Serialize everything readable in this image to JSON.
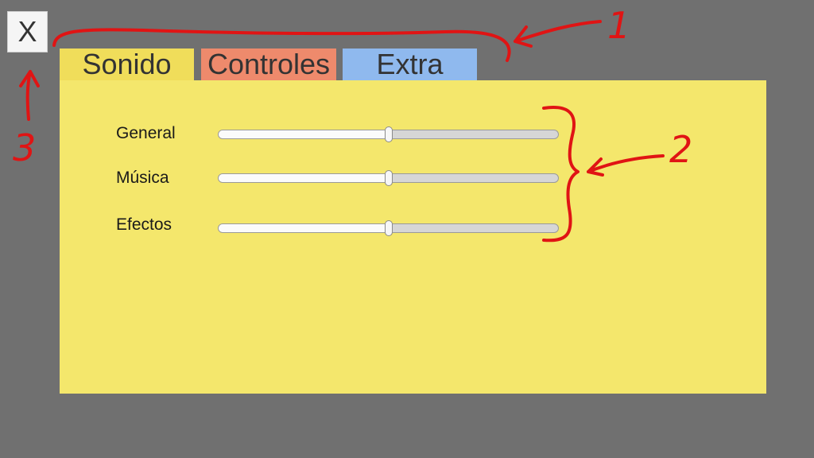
{
  "close_button": {
    "label": "X"
  },
  "tabs": [
    {
      "label": "Sonido",
      "color": "#f0dd5a",
      "selected": true
    },
    {
      "label": "Controles",
      "color": "#ee8a6c",
      "selected": false
    },
    {
      "label": "Extra",
      "color": "#8fb9ee",
      "selected": false
    }
  ],
  "panel": {
    "background": "#f4e76c",
    "sliders": [
      {
        "label": "General",
        "value": 0.5
      },
      {
        "label": "Música",
        "value": 0.5
      },
      {
        "label": "Efectos",
        "value": 0.5
      }
    ]
  },
  "annotations": {
    "color": "#e01414",
    "numbers": [
      "1",
      "2",
      "3"
    ]
  }
}
